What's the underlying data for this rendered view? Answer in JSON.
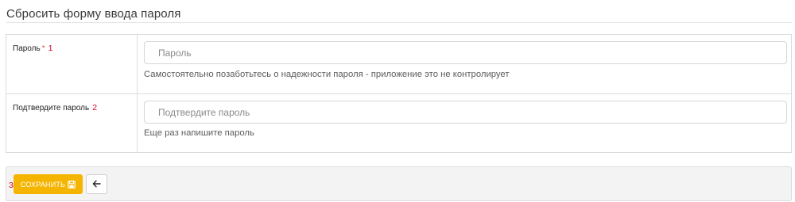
{
  "page": {
    "title": "Сбросить форму ввода пароля"
  },
  "form": {
    "password": {
      "label": "Пароль",
      "required_mark": "*",
      "marker": "1",
      "placeholder": "Пароль",
      "value": "",
      "help": "Самостоятельно позаботьтесь о надежности пароля - приложение это не контролирует"
    },
    "confirm": {
      "label": "Подтвердите пароль",
      "marker": "2",
      "placeholder": "Подтвердите пароль",
      "value": "",
      "help": "Еще раз напишите пароль"
    }
  },
  "actions": {
    "marker": "3",
    "save_label": "СОХРАНИТЬ",
    "save_icon": "floppy-disk-icon",
    "back_icon": "arrow-left-icon"
  },
  "colors": {
    "accent": "#f5b400",
    "marker": "#d9002c",
    "required": "#d9534f"
  }
}
